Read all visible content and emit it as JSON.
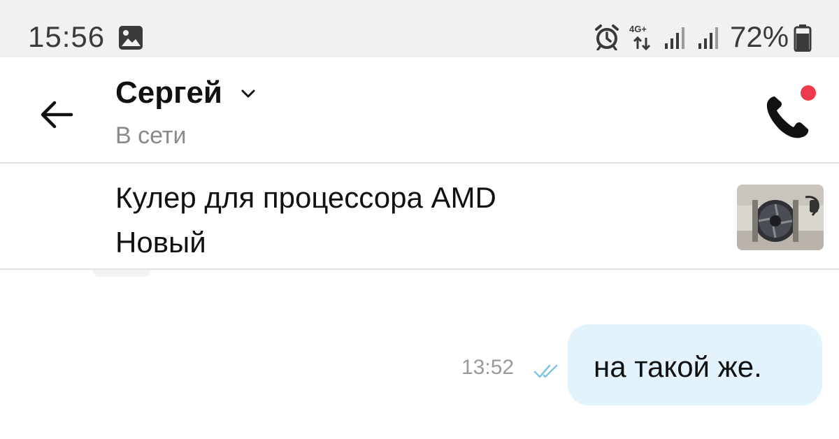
{
  "status_bar": {
    "time": "15:56",
    "network_label": "4G+",
    "battery_percent": "72%",
    "icons": [
      "gallery-icon",
      "alarm-icon",
      "network-arrows-icon",
      "signal-icon",
      "signal-icon",
      "battery-icon"
    ]
  },
  "header": {
    "contact_name": "Сергей",
    "contact_status": "В сети",
    "icons": [
      "back-arrow-icon",
      "chevron-down-icon",
      "phone-icon"
    ],
    "notification_dot_color": "#ef3a4e"
  },
  "product": {
    "title": "Кулер для процессора AMD",
    "condition": "Новый"
  },
  "messages": [
    {
      "direction": "outgoing",
      "text": "на такой же.",
      "time": "13:52",
      "status_icon": "double-check-icon",
      "bubble_color": "#e2f3fd"
    }
  ]
}
